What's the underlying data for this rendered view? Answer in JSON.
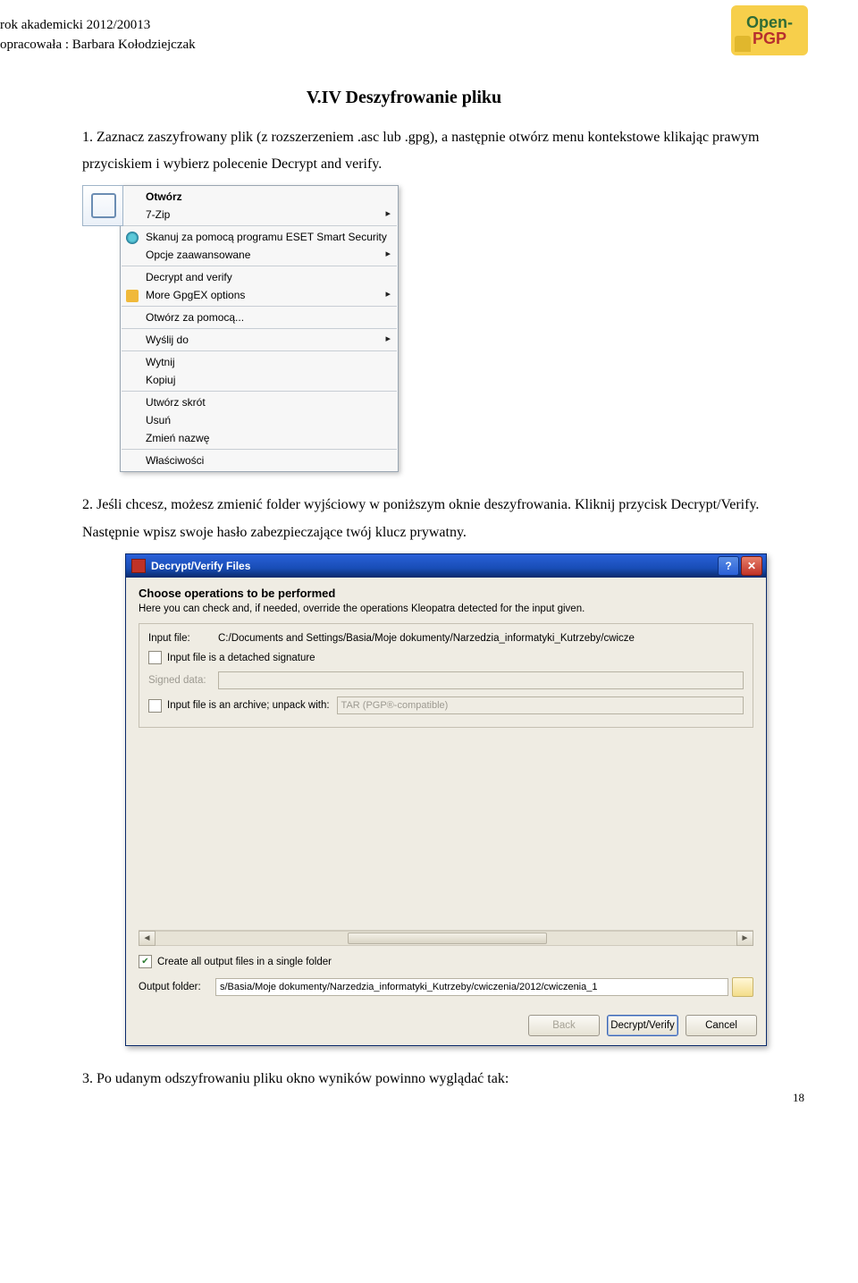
{
  "header": {
    "line1": "rok akademicki 2012/20013",
    "line2": "opracowała : Barbara Kołodziejczak"
  },
  "logo": {
    "top": "Open-",
    "bottom": "PGP"
  },
  "section_title": "V.IV Deszyfrowanie pliku",
  "para1": "1. Zaznacz zaszyfrowany plik (z rozszerzeniem .asc lub .gpg),  a następnie otwórz menu kontekstowe klikając prawym przyciskiem i wybierz polecenie Decrypt and verify.",
  "context_menu": {
    "items": [
      "Otwórz",
      "7-Zip",
      "Skanuj za pomocą programu ESET Smart Security",
      "Opcje zaawansowane",
      "Decrypt and verify",
      "More GpgEX options",
      "Otwórz za pomocą...",
      "Wyślij do",
      "Wytnij",
      "Kopiuj",
      "Utwórz skrót",
      "Usuń",
      "Zmień nazwę",
      "Właściwości"
    ]
  },
  "para2": "2. Jeśli chcesz, możesz zmienić folder wyjściowy w poniższym oknie deszyfrowania. Kliknij przycisk Decrypt/Verify. Następnie wpisz swoje hasło zabezpieczające twój klucz prywatny.",
  "dialog": {
    "title": "Decrypt/Verify Files",
    "heading": "Choose operations to be performed",
    "sub": "Here you can check and, if needed, override the operations Kleopatra detected for the input given.",
    "input_label": "Input file:",
    "input_value": "C:/Documents and Settings/Basia/Moje dokumenty/Narzedzia_informatyki_Kutrzeby/cwicze",
    "cb_detached": "Input file is a detached signature",
    "signed_label": "Signed data:",
    "cb_archive": "Input file is an archive; unpack with:",
    "archive_combo": "TAR (PGP®-compatible)",
    "cb_allout": "Create all output files in a single folder",
    "output_label": "Output folder:",
    "output_value": "s/Basia/Moje dokumenty/Narzedzia_informatyki_Kutrzeby/cwiczenia/2012/cwiczenia_1",
    "buttons": {
      "back": "Back",
      "decrypt": "Decrypt/Verify",
      "cancel": "Cancel"
    }
  },
  "para3": "3. Po udanym odszyfrowaniu pliku okno wyników powinno wyglądać tak:",
  "page_number": "18"
}
